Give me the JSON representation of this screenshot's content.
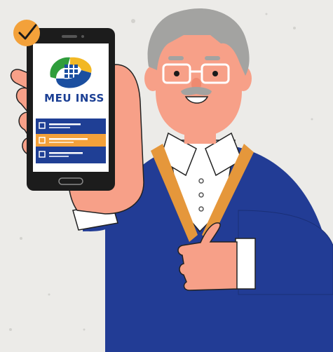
{
  "app": {
    "name": "MEU INSS",
    "name_color": "#1b3f94",
    "logo_colors": {
      "green": "#2f9d3c",
      "yellow": "#f2b824",
      "blue": "#1b4fa0"
    }
  },
  "checklist": {
    "items": [
      {
        "state": "unchecked"
      },
      {
        "state": "highlighted"
      },
      {
        "state": "unchecked"
      }
    ],
    "bg_color": "#1f3f95",
    "highlight_color": "#f3a13a"
  },
  "badge": {
    "icon": "checkmark-icon",
    "color": "#f3a13a"
  },
  "colors": {
    "background": "#ecebe8",
    "skin": "#f7a088",
    "sweater": "#223c95",
    "stripe": "#e5973b",
    "hair": "#a3a3a1"
  }
}
